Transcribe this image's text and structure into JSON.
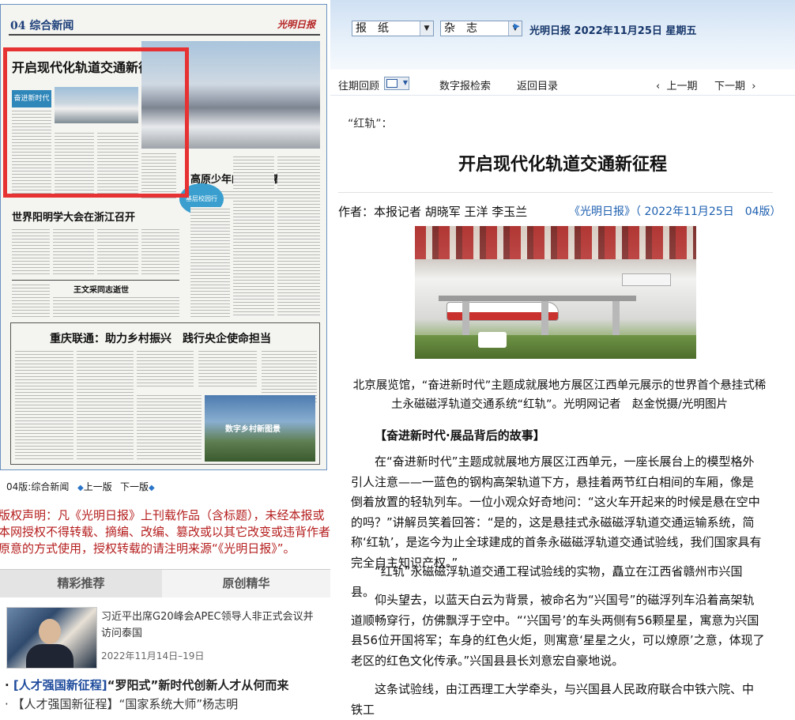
{
  "newspaper": {
    "page_label": "04 综合新闻",
    "masthead": "光明日报",
    "headline_main": "开启现代化轨道交通新征程",
    "headline_2": "世界阳明学大会在浙江召开",
    "headline_3": "重庆联通：助力乡村振兴　践行央企使命担当",
    "subhead_1": "高原少年的多彩青春",
    "subhead_2": "王文采同志逝世",
    "badge_1": "奋进新时代",
    "badge_2": "基层校园行",
    "photo_text": "数字乡村新图景"
  },
  "page_nav": {
    "page": "04版:综合新闻",
    "prev": "上一版",
    "next": "下一版"
  },
  "copyright": "版权声明：凡《光明日报》上刊载作品（含标题），未经本报或本网授权不得转载、摘编、改编、篡改或以其它改变或违背作者原意的方式使用，授权转载的请注明来源“《光明日报》”。",
  "tabs": {
    "featured": "精彩推荐",
    "original": "原创精华"
  },
  "recommend": {
    "title": "习近平出席G20峰会APEC领导人非正式会议并访问泰国",
    "date": "2022年11月14日–19日",
    "link1_tag": "[人才强国新征程]",
    "link1_text": "“罗阳式”新时代创新人才从何而来",
    "link2_text": "【人才强国新征程】“国家系统大师”杨志明"
  },
  "topbar": {
    "select1": "报　纸",
    "select2": "杂　志",
    "date_line": "光明日报  2022年11月25日  星期五"
  },
  "navbar": {
    "archive": "往期回顾",
    "search": "数字报检索",
    "back": "返回目录",
    "prev_issue": "上一期",
    "next_issue": "下一期"
  },
  "article": {
    "kicker": "“红轨”：",
    "title": "开启现代化轨道交通新征程",
    "author": "作者：本报记者  胡晓军  王洋  李玉兰",
    "source": "《光明日报》（ 2022年11月25日　04版）",
    "caption": "北京展览馆，“奋进新时代”主题成就展地方展区江西单元展示的世界首个悬挂式稀土永磁磁浮轨道交通系统“红轨”。光明网记者　赵金悦摄/光明图片",
    "section_head": "【奋进新时代·展品背后的故事】",
    "paragraphs": [
      "在“奋进新时代”主题成就展地方展区江西单元，一座长展台上的模型格外引人注意——一蓝色的钢构高架轨道下方，悬挂着两节红白相间的车厢，像是倒着放置的轻轨列车。一位小观众好奇地问：“这火车开起来的时候是悬在空中的吗？”讲解员笑着回答：“是的，这是悬挂式永磁磁浮轨道交通运输系统，简称‘红轨’，是迄今为止全球建成的首条永磁磁浮轨道交通试验线，我们国家具有完全自主知识产权。”",
      "“红轨”永磁磁浮轨道交通工程试验线的实物，矗立在江西省赣州市兴国县。",
      "仰头望去，以蓝天白云为背景，被命名为“兴国号”的磁浮列车沿着高架轨道顺畅穿行，仿佛飘浮于空中。“‘兴国号’的车头两侧有56颗星星，寓意为兴国县56位开国将军；车身的红色火炬，则寓意‘星星之火，可以燎原’之意，体现了老区的红色文化传承。”兴国县县长刘意宏自豪地说。",
      "这条试验线，由江西理工大学牵头，与兴国县人民政府联合中铁六院、中铁工"
    ]
  }
}
